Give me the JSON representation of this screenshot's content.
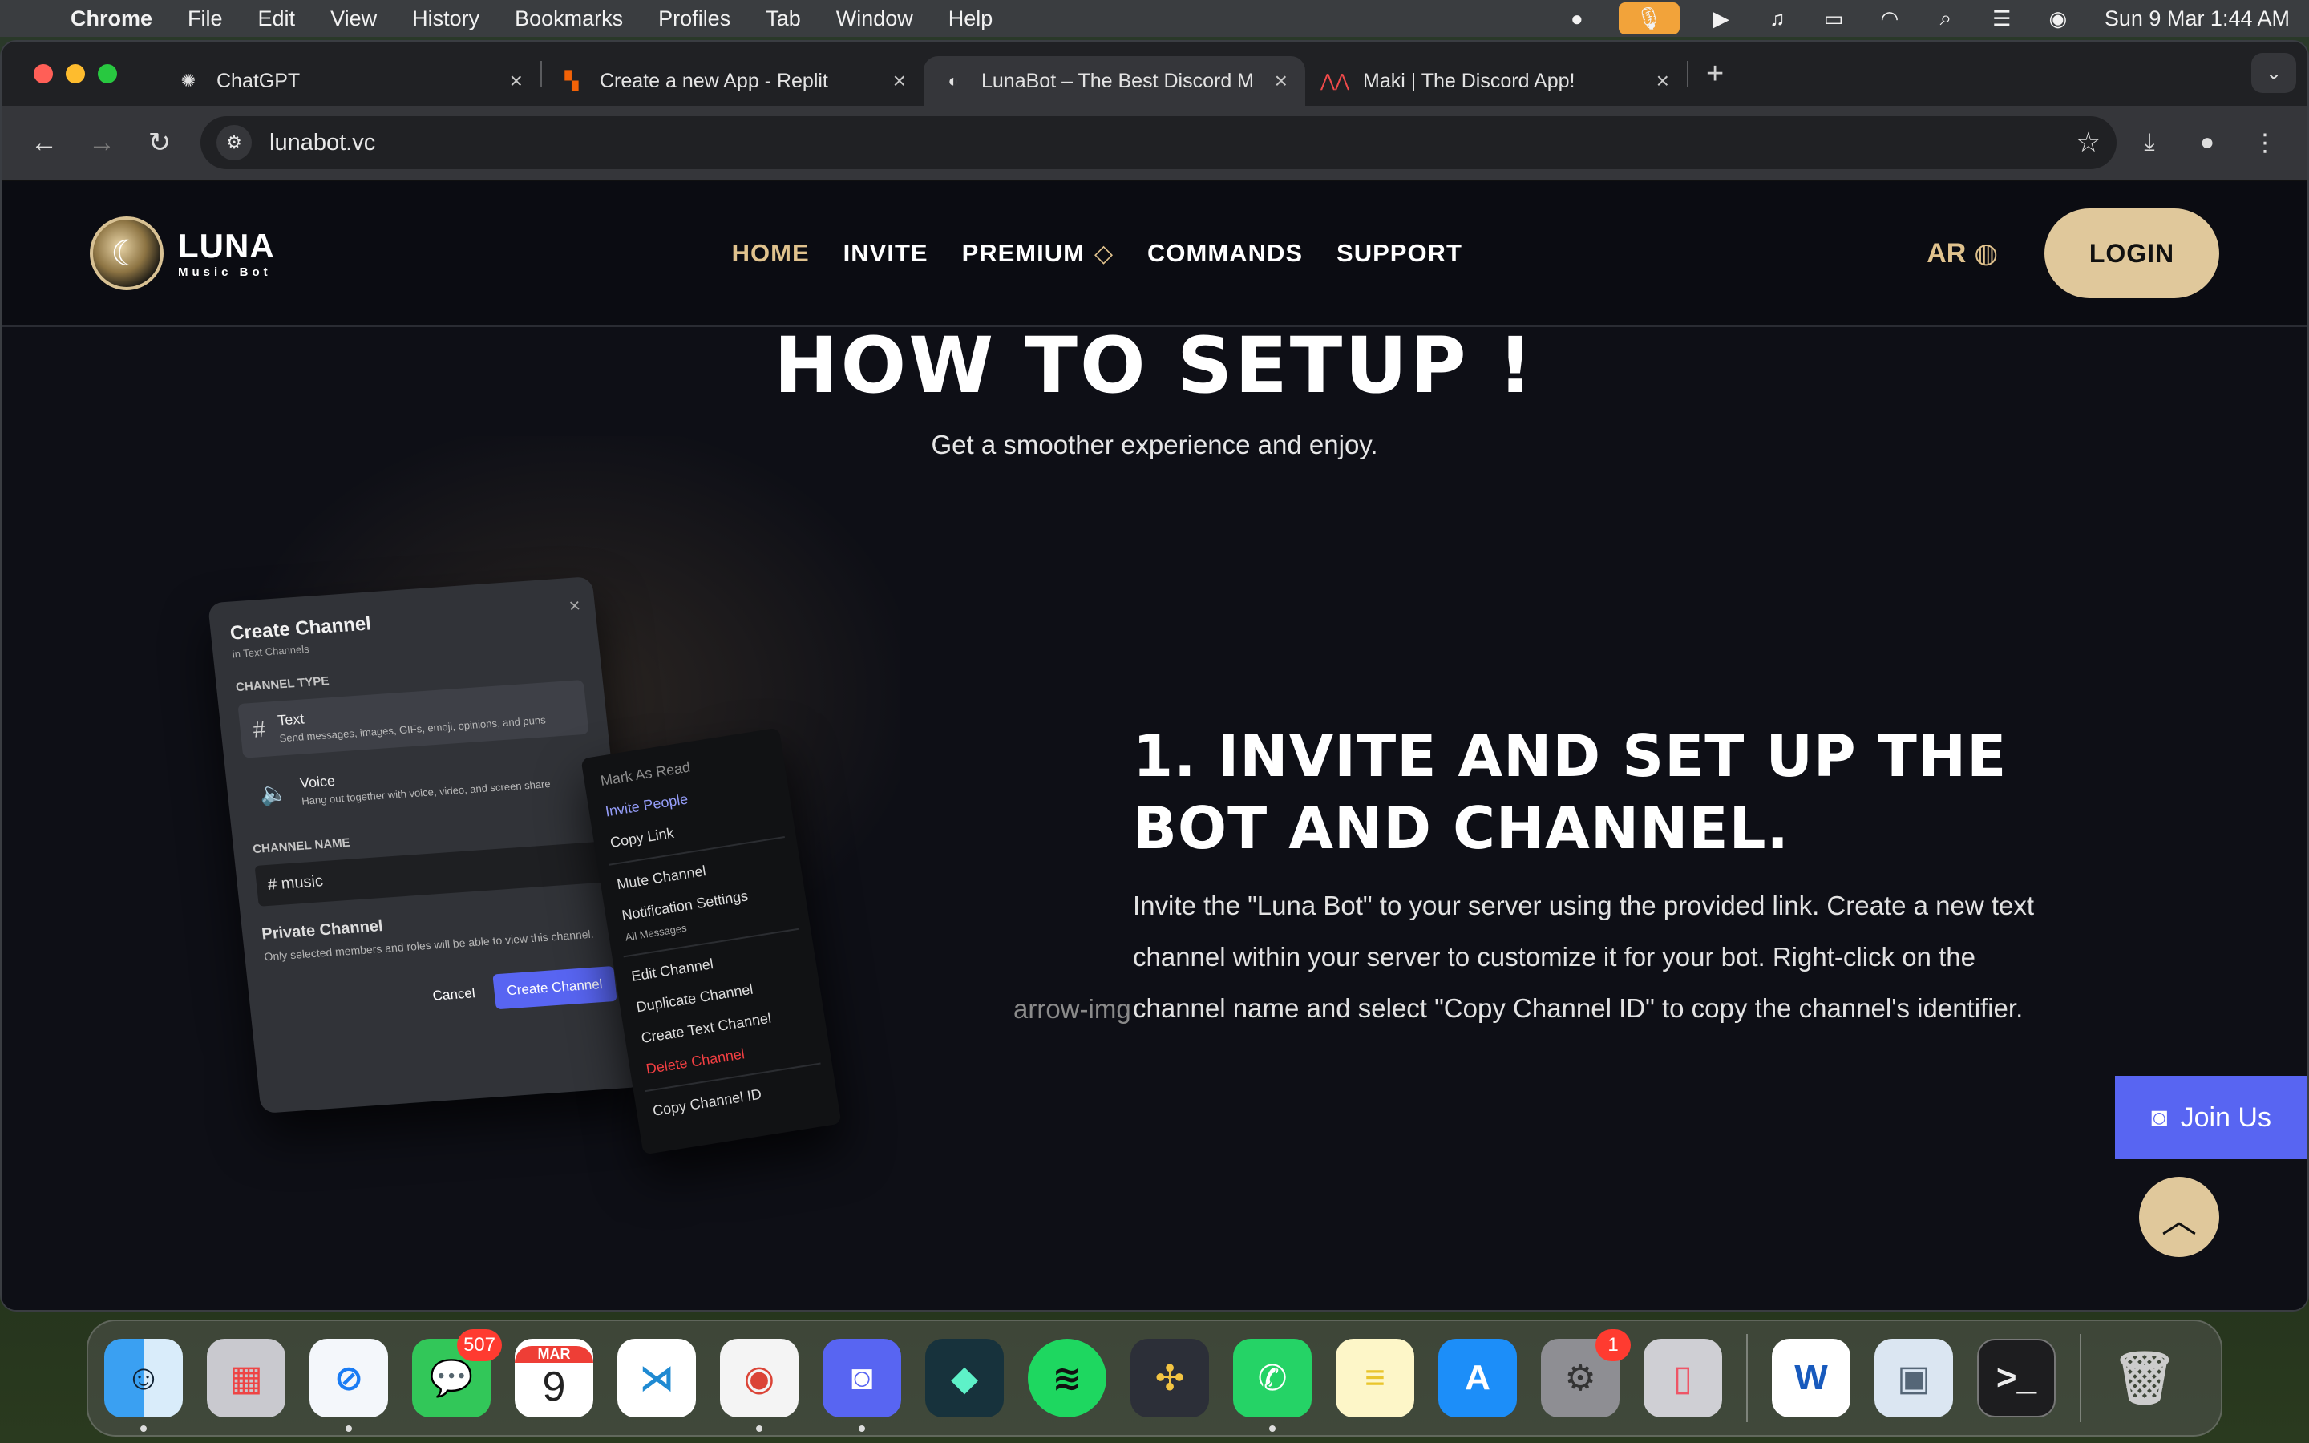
{
  "menubar": {
    "app_name": "Chrome",
    "items": [
      "File",
      "Edit",
      "View",
      "History",
      "Bookmarks",
      "Profiles",
      "Tab",
      "Window",
      "Help"
    ],
    "clock": "Sun 9 Mar  1:44 AM"
  },
  "tabs": [
    {
      "title": "ChatGPT",
      "icon": "chatgpt-icon"
    },
    {
      "title": "Create a new App - Replit",
      "icon": "replit-icon"
    },
    {
      "title": "LunaBot – The Best Discord M",
      "icon": "lunabot-icon",
      "active": true
    },
    {
      "title": "Maki | The Discord App!",
      "icon": "maki-icon"
    }
  ],
  "address": {
    "url": "lunabot.vc"
  },
  "site": {
    "logo_name": "LUNA",
    "logo_sub": "Music Bot",
    "nav": {
      "home": "HOME",
      "invite": "INVITE",
      "premium": "PREMIUM",
      "commands": "COMMANDS",
      "support": "SUPPORT"
    },
    "language": "AR",
    "login": "LOGIN"
  },
  "section": {
    "title": "HOW TO SETUP !",
    "subtitle": "Get a smoother experience and enjoy.",
    "arrow_alt": "arrow-img"
  },
  "step": {
    "title": "1. INVITE AND SET UP THE BOT AND CHANNEL.",
    "description": "Invite the \"Luna Bot\" to your server using the provided link. Create a new text channel within your server to customize it for your bot. Right-click on the channel name and select \"Copy Channel ID\" to copy the channel's identifier."
  },
  "illustration": {
    "dialog_title": "Create Channel",
    "dialog_sub": "in Text Channels",
    "type_label": "CHANNEL TYPE",
    "text_title": "Text",
    "text_desc": "Send messages, images, GIFs, emoji, opinions, and puns",
    "voice_title": "Voice",
    "voice_desc": "Hang out together with voice, video, and screen share",
    "name_label": "CHANNEL NAME",
    "name_value": "# music",
    "private_title": "Private Channel",
    "private_desc": "Only selected members and roles will be able to view this channel.",
    "cancel": "Cancel",
    "create": "Create Channel",
    "menu": {
      "mark_read": "Mark As Read",
      "invite": "Invite People",
      "copy_link": "Copy Link",
      "mute": "Mute Channel",
      "notif": "Notification Settings",
      "notif_sub": "All Messages",
      "edit": "Edit Channel",
      "duplicate": "Duplicate Channel",
      "create_text": "Create Text Channel",
      "delete": "Delete Channel",
      "copy_id": "Copy Channel ID"
    }
  },
  "join_us": "Join Us",
  "dock": {
    "messages_badge": "507",
    "calendar_month": "MAR",
    "calendar_day": "9",
    "settings_badge": "1"
  }
}
